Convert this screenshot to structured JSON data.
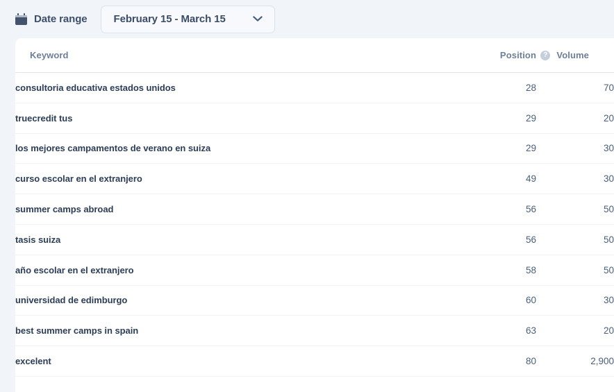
{
  "toolbar": {
    "calendar_icon": "calendar-icon",
    "label": "Date range",
    "selected_range": "February 15 - March 15",
    "chevron_icon": "chevron-down-icon"
  },
  "table": {
    "columns": {
      "keyword": "Keyword",
      "position": "Position",
      "volume": "Volume",
      "volume_help_icon": "?"
    },
    "rows": [
      {
        "keyword": "consultoria educativa estados unidos",
        "position": "28",
        "volume": "70"
      },
      {
        "keyword": "truecredit tus",
        "position": "29",
        "volume": "20"
      },
      {
        "keyword": "los mejores campamentos de verano en suiza",
        "position": "29",
        "volume": "30"
      },
      {
        "keyword": "curso escolar en el extranjero",
        "position": "49",
        "volume": "30"
      },
      {
        "keyword": "summer camps abroad",
        "position": "56",
        "volume": "50"
      },
      {
        "keyword": "tasis suiza",
        "position": "56",
        "volume": "50"
      },
      {
        "keyword": "año escolar en el extranjero",
        "position": "58",
        "volume": "50"
      },
      {
        "keyword": "universidad de edimburgo",
        "position": "60",
        "volume": "30"
      },
      {
        "keyword": "best summer camps in spain",
        "position": "63",
        "volume": "20"
      },
      {
        "keyword": "excelent",
        "position": "80",
        "volume": "2,900"
      }
    ]
  },
  "colors": {
    "page_background": "#f1f4f9",
    "card_background": "#ffffff",
    "keyword_text": "#2c3e57",
    "number_text": "#4a5f7b",
    "header_text": "#6d7f97",
    "accent_border": "#dbe2ec"
  }
}
